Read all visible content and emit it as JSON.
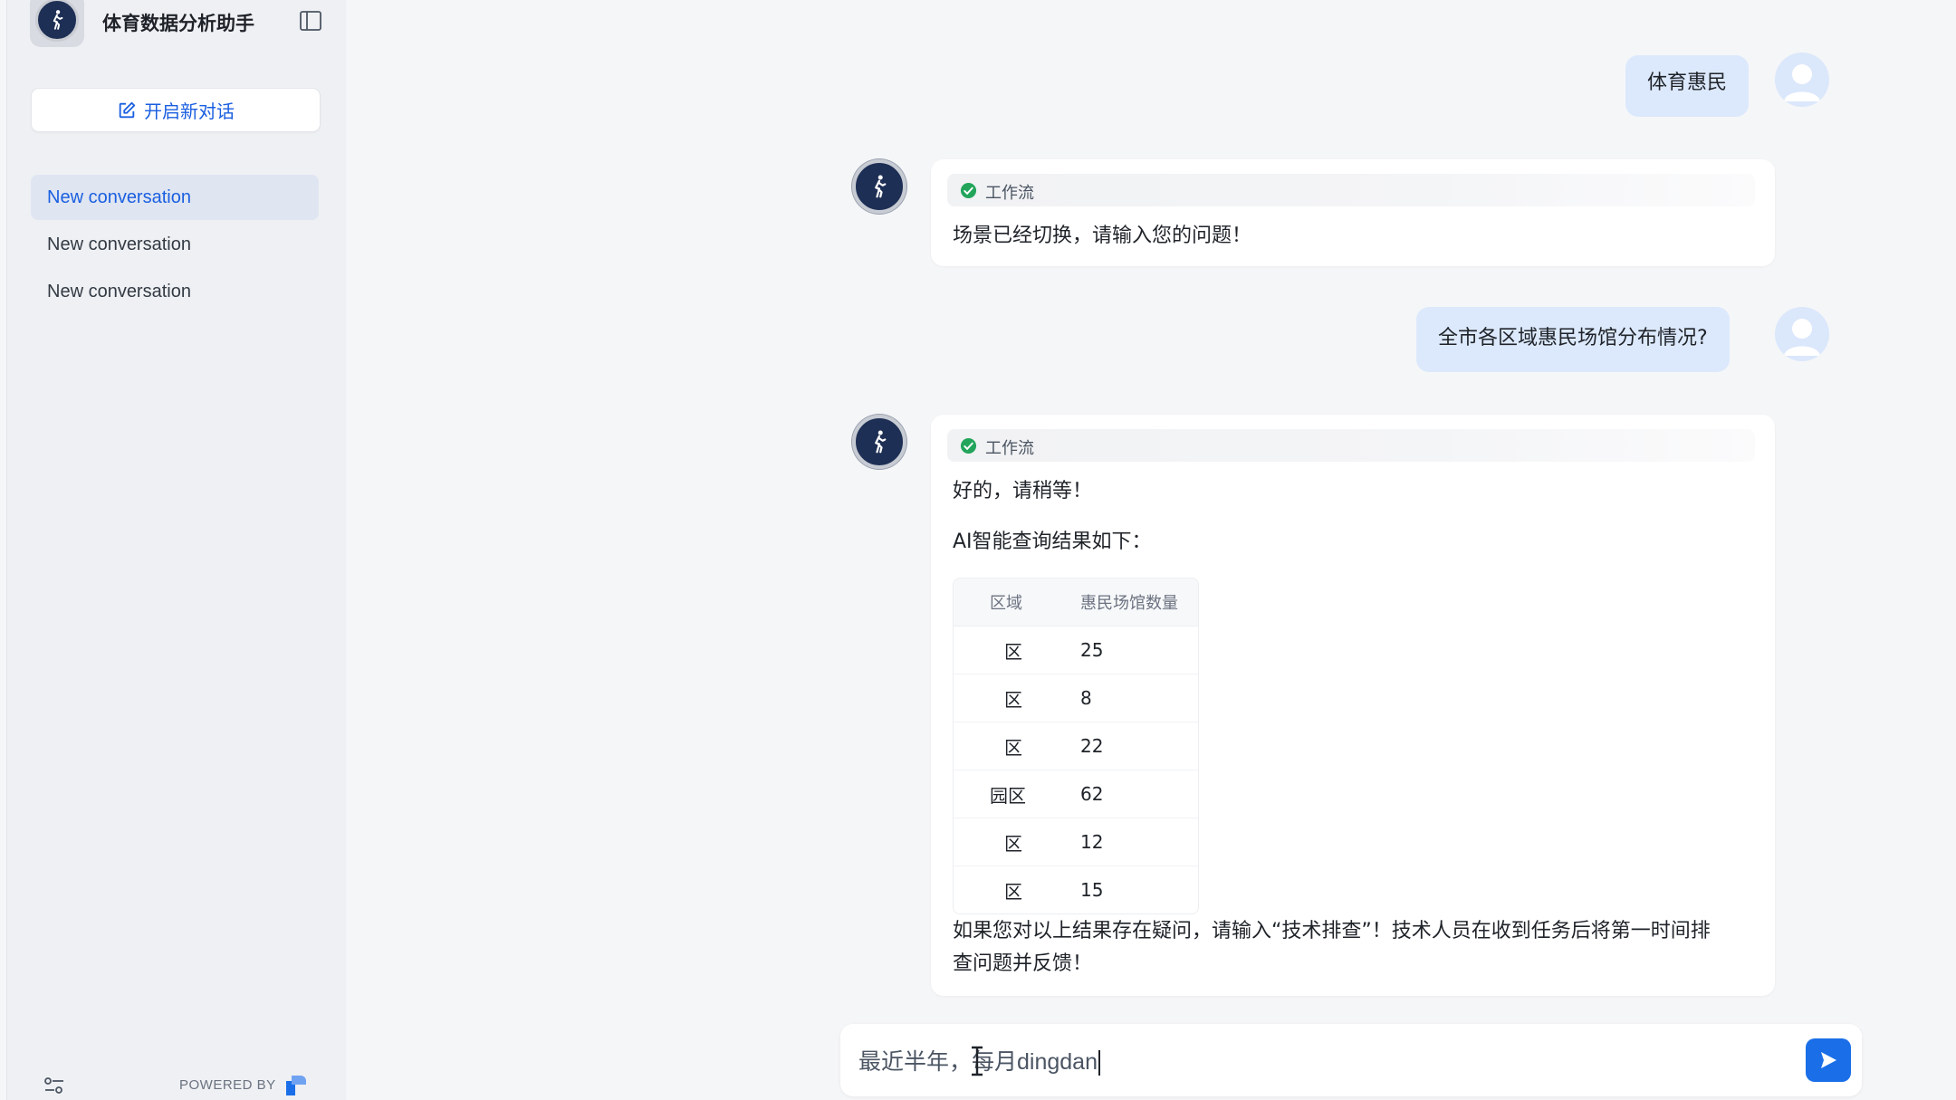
{
  "app": {
    "title": "体育数据分析助手"
  },
  "sidebar": {
    "new_chat_label": "开启新对话",
    "conversations": [
      {
        "label": "New conversation",
        "active": true
      },
      {
        "label": "New conversation",
        "active": false
      },
      {
        "label": "New conversation",
        "active": false
      }
    ],
    "footer": {
      "powered_by": "POWERED BY"
    }
  },
  "messages": {
    "user1": "体育惠民",
    "bot1": {
      "workflow": "工作流",
      "text": "场景已经切换，请输入您的问题！"
    },
    "user2": "全市各区域惠民场馆分布情况?",
    "bot2": {
      "workflow": "工作流",
      "line1": "好的，请稍等！",
      "line2": "AI智能查询结果如下：",
      "table": {
        "headers": [
          "区域",
          "惠民场馆数量"
        ],
        "rows": [
          [
            "区",
            "25"
          ],
          [
            "区",
            "8"
          ],
          [
            "区",
            "22"
          ],
          [
            "园区",
            "62"
          ],
          [
            "区",
            "12"
          ],
          [
            "区",
            "15"
          ]
        ]
      },
      "footer_line1": "如果您对以上结果存在疑问，请输入“技术排查”！技术人员在收到任务后将第一时间排",
      "footer_line2": "查问题并反馈！"
    }
  },
  "composer": {
    "value": "最近半年，每月dingdan"
  },
  "colors": {
    "accent": "#1a6fe8",
    "user_bubble": "#dce9fc",
    "workflow_check": "#22a55b"
  },
  "icons": {
    "app_logo": "runner-icon",
    "sidebar_toggle": "sidebar-toggle-icon",
    "new_chat": "edit-icon",
    "workflow_status": "check-circle-icon",
    "send": "send-icon",
    "settings": "sliders-icon"
  }
}
